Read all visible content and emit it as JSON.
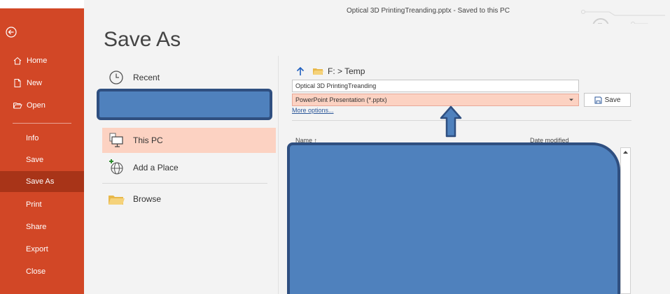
{
  "app": {
    "document_title": "Optical 3D PrintingTreanding.pptx  -  Saved to this PC"
  },
  "sidebar": {
    "back_icon": "back-arrow-circle-icon",
    "items": [
      {
        "label": "Home",
        "icon": "home-icon"
      },
      {
        "label": "New",
        "icon": "new-document-icon"
      },
      {
        "label": "Open",
        "icon": "open-folder-icon"
      },
      {
        "label": "Info"
      },
      {
        "label": "Save"
      },
      {
        "label": "Save As",
        "active": true
      },
      {
        "label": "Print"
      },
      {
        "label": "Share"
      },
      {
        "label": "Export"
      },
      {
        "label": "Close"
      }
    ]
  },
  "page": {
    "title": "Save As"
  },
  "locations": [
    {
      "label": "Recent",
      "icon": "clock-icon"
    },
    {
      "label": "This PC",
      "icon": "computer-icon",
      "selected": true
    },
    {
      "label": "Add a Place",
      "icon": "globe-add-icon"
    },
    {
      "label": "Browse",
      "icon": "folder-icon"
    }
  ],
  "save_panel": {
    "path": "F: > Temp",
    "filename_value": "Optical 3D PrintingTreanding",
    "filetype_value": "PowerPoint Presentation (*.pptx)",
    "save_label": "Save",
    "more_options_label": "More options...",
    "columns": {
      "name": "Name ↑",
      "date": "Date modified"
    }
  },
  "colors": {
    "accent": "#d24726",
    "active": "#a83418",
    "selected": "#fcd2c2",
    "redaction": "#4f81bd"
  }
}
